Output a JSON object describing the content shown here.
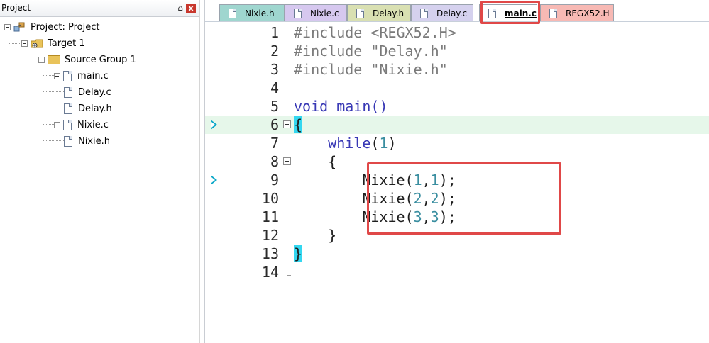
{
  "project_pane": {
    "title": "Project",
    "pin_glyph": "⌂",
    "close_glyph": "x",
    "tree": {
      "project_label": "Project: Project",
      "target_label": "Target 1",
      "group_label": "Source Group 1",
      "files": [
        {
          "name": "main.c",
          "expandable": true
        },
        {
          "name": "Delay.c",
          "expandable": false
        },
        {
          "name": "Delay.h",
          "expandable": false
        },
        {
          "name": "Nixie.c",
          "expandable": true
        },
        {
          "name": "Nixie.h",
          "expandable": false
        }
      ]
    }
  },
  "tabs": [
    {
      "label": "Nixie.h",
      "color": "#9fd6cf",
      "active": false
    },
    {
      "label": "Nixie.c",
      "color": "#d6c8ef",
      "active": false
    },
    {
      "label": "Delay.h",
      "color": "#d9e0b2",
      "active": false
    },
    {
      "label": "Delay.c",
      "color": "#d5d1ee",
      "active": false
    },
    {
      "label": "main.c",
      "color": "#ffffff",
      "active": true
    },
    {
      "label": "REGX52.H",
      "color": "#f7b9b4",
      "active": false
    }
  ],
  "editor": {
    "current_line": 6,
    "lines": [
      {
        "n": "1",
        "text": "#include <REGX52.H>"
      },
      {
        "n": "2",
        "text": "#include \"Delay.h\""
      },
      {
        "n": "3",
        "text": "#include \"Nixie.h\""
      },
      {
        "n": "4",
        "text": ""
      },
      {
        "n": "5",
        "text": "void main()"
      },
      {
        "n": "6",
        "text": "{"
      },
      {
        "n": "7",
        "text": "    while(1)"
      },
      {
        "n": "8",
        "text": "    {"
      },
      {
        "n": "9",
        "text": "        Nixie(1,1);"
      },
      {
        "n": "10",
        "text": "        Nixie(2,2);"
      },
      {
        "n": "11",
        "text": "        Nixie(3,3);"
      },
      {
        "n": "12",
        "text": "    }"
      },
      {
        "n": "13",
        "text": "}"
      },
      {
        "n": "14",
        "text": ""
      }
    ],
    "breakpoint_lines": [
      6,
      9
    ]
  },
  "colors": {
    "keyword": "#3838b5",
    "preprocessor": "#7a7a7a",
    "number": "#3a8ea0",
    "current_line_bg": "#e6f7ea",
    "brace_match": "#33d7f0",
    "annotation_box": "#e04848"
  }
}
